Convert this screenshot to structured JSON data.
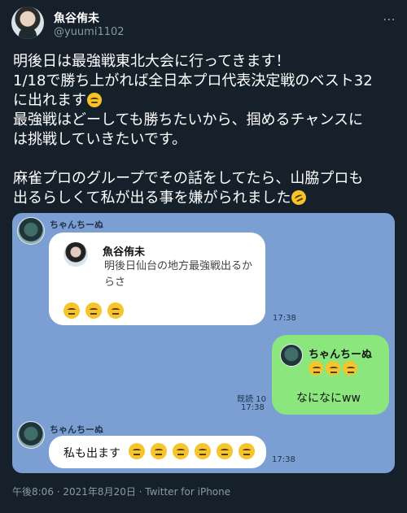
{
  "profile": {
    "name": "魚谷侑未",
    "handle": "@yuumi1102"
  },
  "tweet": {
    "line1": "明後日は最強戦東北大会に行ってきます！",
    "line2": "1/18で勝ち上がれば全日本プロ代表決定戦のベスト32",
    "line3": "に出れます",
    "line4": "最強戦はどーしても勝ちたいから、掴めるチャンスに",
    "line5": "は挑戦していきたいです。",
    "line6": "麻雀プロのグループでその話をしてたら、山脇プロも",
    "line7": "出るらしくて私が出る事を嫌がられました"
  },
  "chat": {
    "sender1": "ちゃんちーぬ",
    "quote_name": "魚谷侑未",
    "quote_text": "明後日仙台の地方最強戦出るからさ",
    "time1": "17:38",
    "reply_name": "ちゃんちーぬ",
    "read": "既読 10",
    "time2": "17:38",
    "reply_text": "なになにww",
    "sender2": "ちゃんちーぬ",
    "message": "私も出ます",
    "time3": "17:38"
  },
  "meta": {
    "footer": "午後8:06 · 2021年8月20日 · Twitter for iPhone"
  }
}
